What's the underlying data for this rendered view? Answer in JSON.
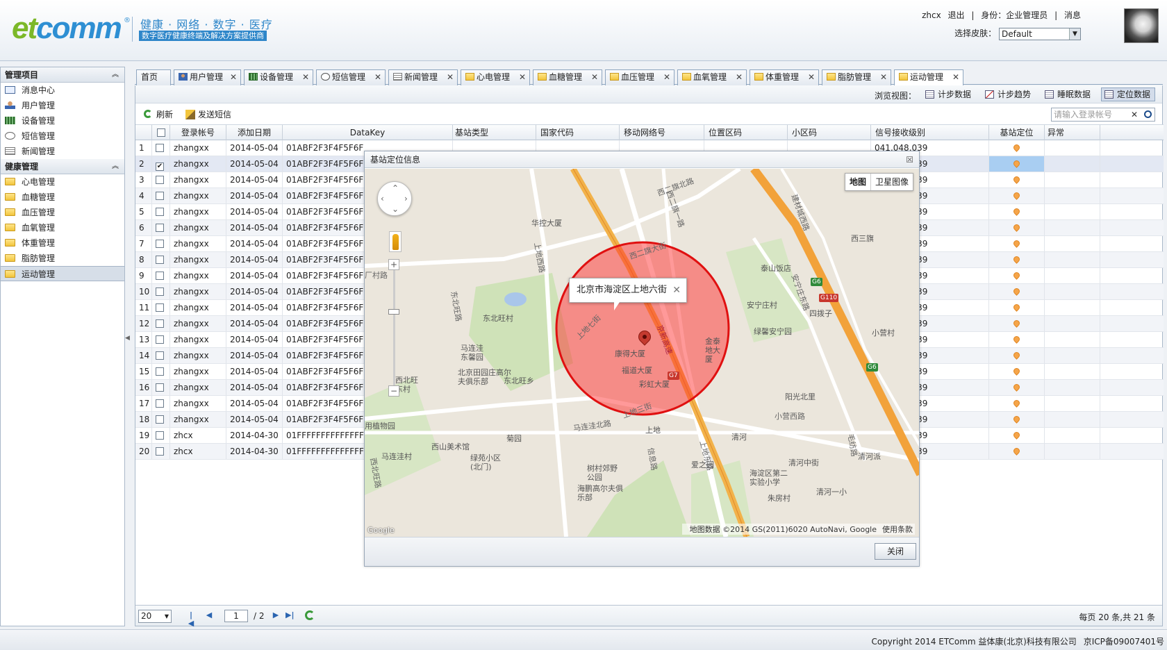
{
  "header": {
    "logo_text": "etcomm",
    "logo_prefix": "et",
    "logo_suffix": "comm",
    "logo_reg": "®",
    "slogan_top": "健康 · 网络 · 数字 · 医疗",
    "slogan_bottom": "数字医疗健康终端及解决方案提供商",
    "username": "zhcx",
    "logout": "退出",
    "identity": "身份：企业管理员",
    "messages": "消息",
    "skin_label": "选择皮肤：",
    "skin_value": "Default"
  },
  "sidebar": {
    "group1_title": "管理项目",
    "group1_items": [
      "消息中心",
      "用户管理",
      "设备管理",
      "短信管理",
      "新闻管理"
    ],
    "group2_title": "健康管理",
    "group2_items": [
      "心电管理",
      "血糖管理",
      "血压管理",
      "血氧管理",
      "体重管理",
      "脂肪管理",
      "运动管理"
    ]
  },
  "tabs": [
    "首页",
    "用户管理",
    "设备管理",
    "短信管理",
    "新闻管理",
    "心电管理",
    "血糖管理",
    "血压管理",
    "血氧管理",
    "体重管理",
    "脂肪管理",
    "运动管理"
  ],
  "view": {
    "label": "浏览视图：",
    "buttons": [
      "计步数据",
      "计步趋势",
      "睡眠数据",
      "定位数据"
    ]
  },
  "toolbar": {
    "refresh": "刷新",
    "send_sms": "发送短信",
    "search_placeholder": "请输入登录帐号"
  },
  "grid": {
    "columns": [
      "登录帐号",
      "添加日期",
      "DataKey",
      "基站类型",
      "国家代码",
      "移动网络号",
      "位置区码",
      "小区码",
      "信号接收级别",
      "基站定位",
      "异常"
    ],
    "rows": [
      {
        "n": "1",
        "user": "zhangxx",
        "date": "2014-05-04",
        "key": "01ABF2F3F4F5F6F",
        "signal": "041,048,039",
        "checked": false
      },
      {
        "n": "2",
        "user": "zhangxx",
        "date": "2014-05-04",
        "key": "01ABF2F3F4F5F6F",
        "signal": "041,048,039",
        "checked": true
      },
      {
        "n": "3",
        "user": "zhangxx",
        "date": "2014-05-04",
        "key": "01ABF2F3F4F5F6F",
        "signal": "041,048,039",
        "checked": false
      },
      {
        "n": "4",
        "user": "zhangxx",
        "date": "2014-05-04",
        "key": "01ABF2F3F4F5F6F",
        "signal": "041,048,039",
        "checked": false
      },
      {
        "n": "5",
        "user": "zhangxx",
        "date": "2014-05-04",
        "key": "01ABF2F3F4F5F6F",
        "signal": "041,048,039",
        "checked": false
      },
      {
        "n": "6",
        "user": "zhangxx",
        "date": "2014-05-04",
        "key": "01ABF2F3F4F5F6F",
        "signal": "041,048,039",
        "checked": false
      },
      {
        "n": "7",
        "user": "zhangxx",
        "date": "2014-05-04",
        "key": "01ABF2F3F4F5F6F",
        "signal": "041,048,039",
        "checked": false
      },
      {
        "n": "8",
        "user": "zhangxx",
        "date": "2014-05-04",
        "key": "01ABF2F3F4F5F6F",
        "signal": "041,048,039",
        "checked": false
      },
      {
        "n": "9",
        "user": "zhangxx",
        "date": "2014-05-04",
        "key": "01ABF2F3F4F5F6F",
        "signal": "041,048,039",
        "checked": false
      },
      {
        "n": "10",
        "user": "zhangxx",
        "date": "2014-05-04",
        "key": "01ABF2F3F4F5F6F",
        "signal": "041,048,039",
        "checked": false
      },
      {
        "n": "11",
        "user": "zhangxx",
        "date": "2014-05-04",
        "key": "01ABF2F3F4F5F6F",
        "signal": "041,048,039",
        "checked": false
      },
      {
        "n": "12",
        "user": "zhangxx",
        "date": "2014-05-04",
        "key": "01ABF2F3F4F5F6F",
        "signal": "041,048,039",
        "checked": false
      },
      {
        "n": "13",
        "user": "zhangxx",
        "date": "2014-05-04",
        "key": "01ABF2F3F4F5F6F",
        "signal": "041,048,039",
        "checked": false
      },
      {
        "n": "14",
        "user": "zhangxx",
        "date": "2014-05-04",
        "key": "01ABF2F3F4F5F6F",
        "signal": "041,048,039",
        "checked": false
      },
      {
        "n": "15",
        "user": "zhangxx",
        "date": "2014-05-04",
        "key": "01ABF2F3F4F5F6F",
        "signal": "041,048,039",
        "checked": false
      },
      {
        "n": "16",
        "user": "zhangxx",
        "date": "2014-05-04",
        "key": "01ABF2F3F4F5F6F",
        "signal": "041,048,039",
        "checked": false
      },
      {
        "n": "17",
        "user": "zhangxx",
        "date": "2014-05-04",
        "key": "01ABF2F3F4F5F6F",
        "signal": "041,048,039",
        "checked": false
      },
      {
        "n": "18",
        "user": "zhangxx",
        "date": "2014-05-04",
        "key": "01ABF2F3F4F5F6F",
        "signal": "041,048,039",
        "checked": false
      },
      {
        "n": "19",
        "user": "zhcx",
        "date": "2014-04-30",
        "key": "01FFFFFFFFFFFFFF",
        "signal": "041,048,039",
        "checked": false
      },
      {
        "n": "20",
        "user": "zhcx",
        "date": "2014-04-30",
        "key": "01FFFFFFFFFFFFFF",
        "signal": "041,048,039",
        "checked": false
      }
    ]
  },
  "pager": {
    "page_size": "20",
    "current": "1",
    "total": "/ 2",
    "info": "每页 20 条,共 21 条"
  },
  "dialog": {
    "title": "基站定位信息",
    "close_x": "☒",
    "close_button": "关闭",
    "map_type_map": "地图",
    "map_type_sat": "卫星图像",
    "info_address": "北京市海淀区上地六街",
    "attribution": "地图数据 ©2014 GS(2011)6020 AutoNavi, Google",
    "terms": "使用条款",
    "google": "Google",
    "labels": [
      "华控大厦",
      "西二旗北路",
      "西二旗大街",
      "西二旗一路",
      "泰山饭店",
      "西三旗",
      "建材城西路",
      "安宁庄东路",
      "安宁庄村",
      "四拨子",
      "绿馨安宁园",
      "小营村",
      "东北旺路",
      "东北旺村",
      "马连洼东馨园",
      "北京田园庄高尔夫俱乐部",
      "东北旺乡",
      "西北旺东村",
      "康得大厦",
      "福道大厦",
      "彩虹大厦",
      "上地西路",
      "上地七街",
      "上地三街",
      "上地东路",
      "金泰地大厦",
      "安宁庄东路",
      "阳光北里",
      "小营西路",
      "马连洼北路",
      "菊园",
      "西山美术馆",
      "绿苑小区(北门)",
      "马连洼村",
      "树村郊野公园",
      "海鹏高尔夫俱乐部",
      "爱之园",
      "清河",
      "上地",
      "清河中街",
      "海淀区第二实验小学",
      "朱房村",
      "清河一小",
      "清河派",
      "毛纺路",
      "用植物园",
      "西北旺路",
      "厂村路",
      "信息路",
      "京新高速"
    ],
    "shields": [
      "G6",
      "G110",
      "G6",
      "G7"
    ]
  },
  "footer": {
    "copyright": "Copyright 2014 ETComm 益体康(北京)科技有限公司",
    "icp": "京ICP备09007401号"
  }
}
